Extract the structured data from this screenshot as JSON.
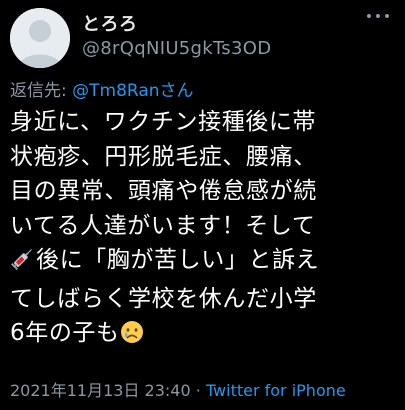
{
  "user": {
    "display_name": "とろろ",
    "handle": "@8rQqNIU5gkTs3OD"
  },
  "reply": {
    "label": "返信先: ",
    "mention": "@Tm8Ranさん"
  },
  "tweet": {
    "lines": [
      "身近に、ワクチン接種後に帯",
      "状疱疹、円形脱毛症、腰痛、",
      "目の異常、頭痛や倦怠感が続",
      "いてる人達がいます！そして",
      "後に「胸が苦しい」と訴え",
      "てしばらく学校を休んだ小学",
      "6年の子も"
    ],
    "emojis": {
      "syringe": "syringe-emoji",
      "crying": "crying-face-emoji"
    }
  },
  "meta": {
    "timestamp": "2021年11月13日 23:40",
    "separator": " · ",
    "source": "Twitter for iPhone"
  },
  "colors": {
    "background": "#000000",
    "text": "#ffffff",
    "secondary": "#8b98a5",
    "link": "#1d9bf0"
  }
}
